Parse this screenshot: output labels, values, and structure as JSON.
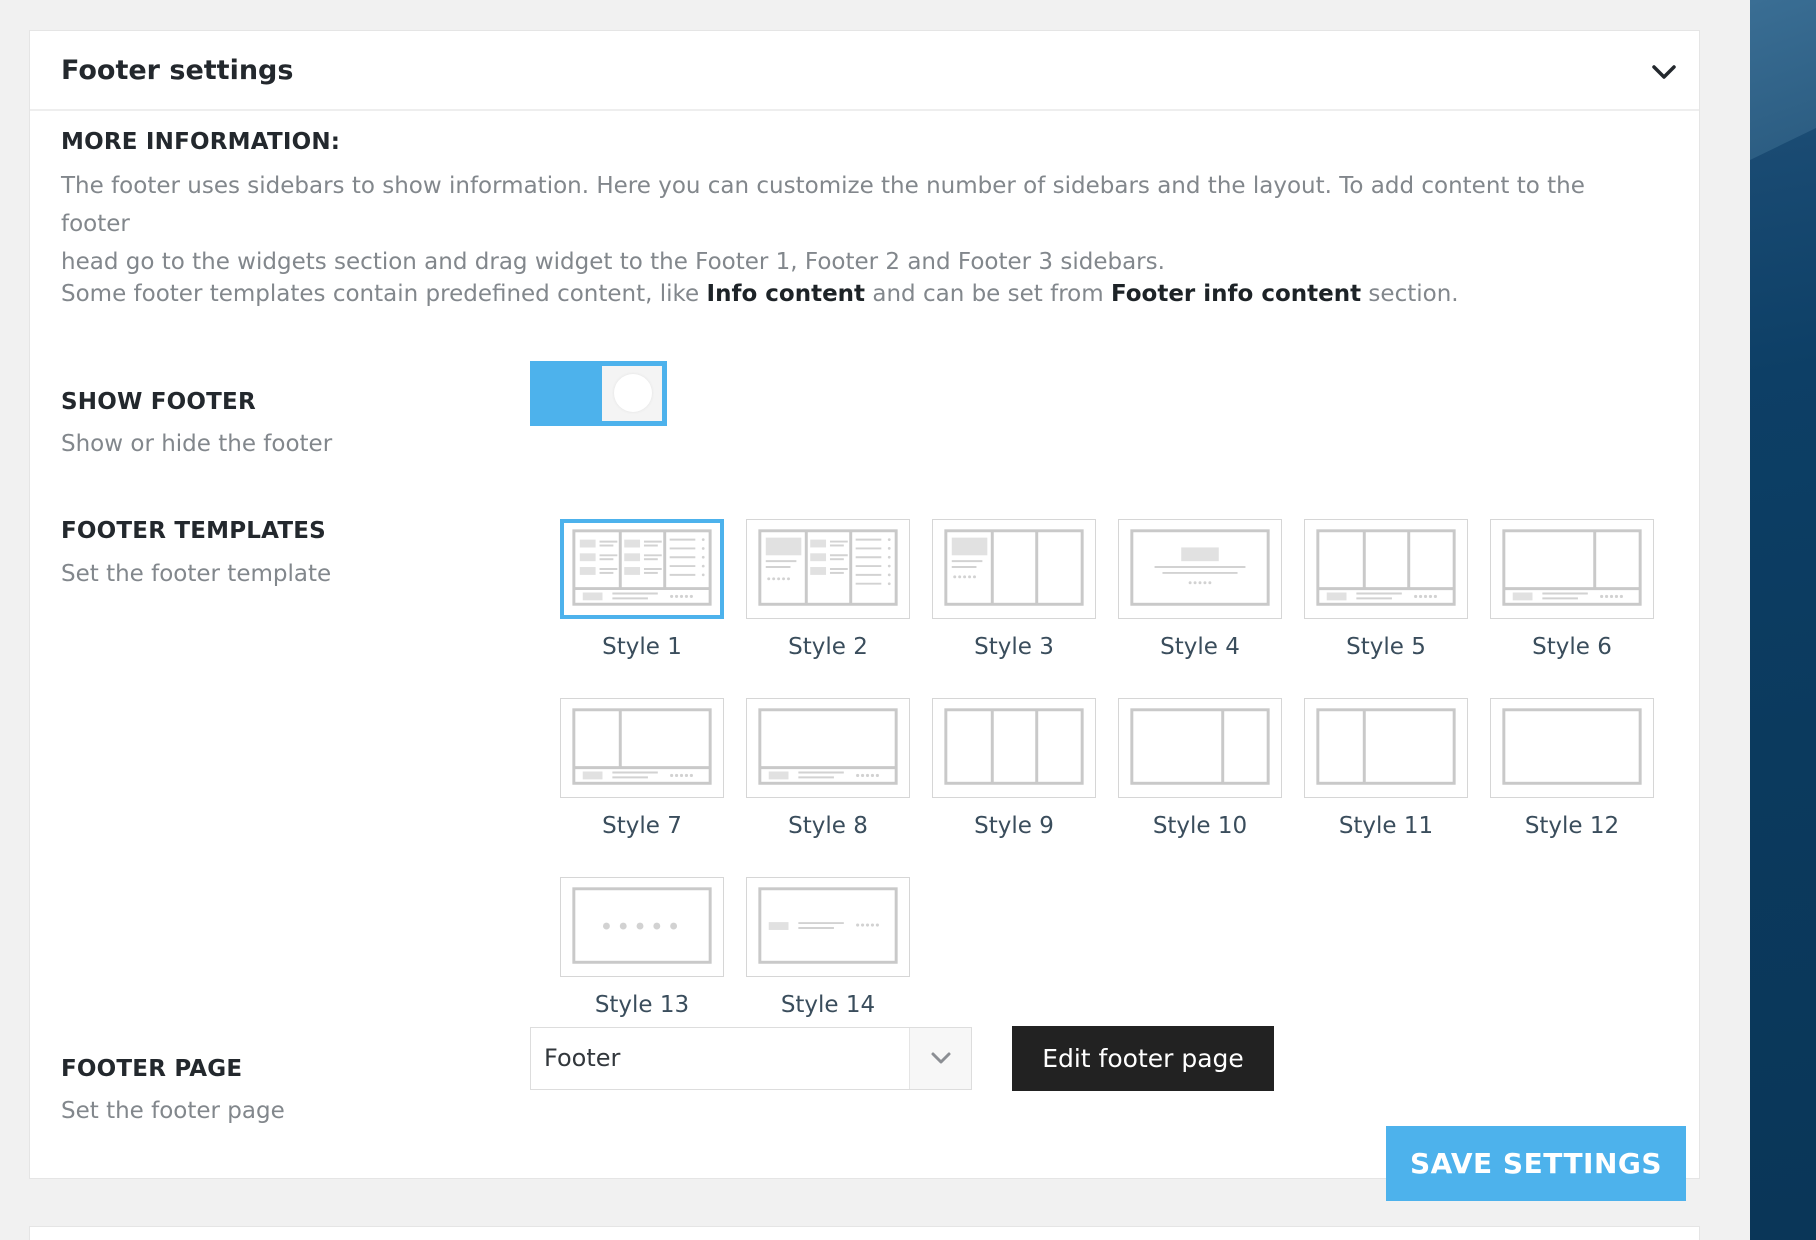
{
  "panel": {
    "title": "Footer settings",
    "toggle_icon": "chevron-down-icon"
  },
  "more_info": {
    "heading": "MORE INFORMATION:",
    "paragraph1_line1": "The footer uses sidebars to show information. Here you can customize the number of sidebars and the layout. To add content to the footer",
    "paragraph1_line2": "head go to the widgets section and drag widget to the Footer 1, Footer 2 and Footer 3 sidebars.",
    "paragraph2_part1": "Some footer templates contain predefined content, like ",
    "paragraph2_bold1": "Info content",
    "paragraph2_part2": " and can be set from ",
    "paragraph2_bold2": "Footer info content",
    "paragraph2_part3": " section."
  },
  "show_footer": {
    "label": "SHOW FOOTER",
    "description": "Show or hide the footer",
    "enabled": true
  },
  "footer_templates": {
    "label": "FOOTER TEMPLATES",
    "description": "Set the footer template",
    "selected": "Style 1",
    "styles": [
      "Style 1",
      "Style 2",
      "Style 3",
      "Style 4",
      "Style 5",
      "Style 6",
      "Style 7",
      "Style 8",
      "Style 9",
      "Style 10",
      "Style 11",
      "Style 12",
      "Style 13",
      "Style 14"
    ]
  },
  "footer_page": {
    "label": "FOOTER PAGE",
    "description": "Set the footer page",
    "selected_value": "Footer",
    "edit_button": "Edit footer page"
  },
  "save_button": "SAVE SETTINGS",
  "colors": {
    "accent": "#4db2ec",
    "dark_button": "#222222"
  }
}
